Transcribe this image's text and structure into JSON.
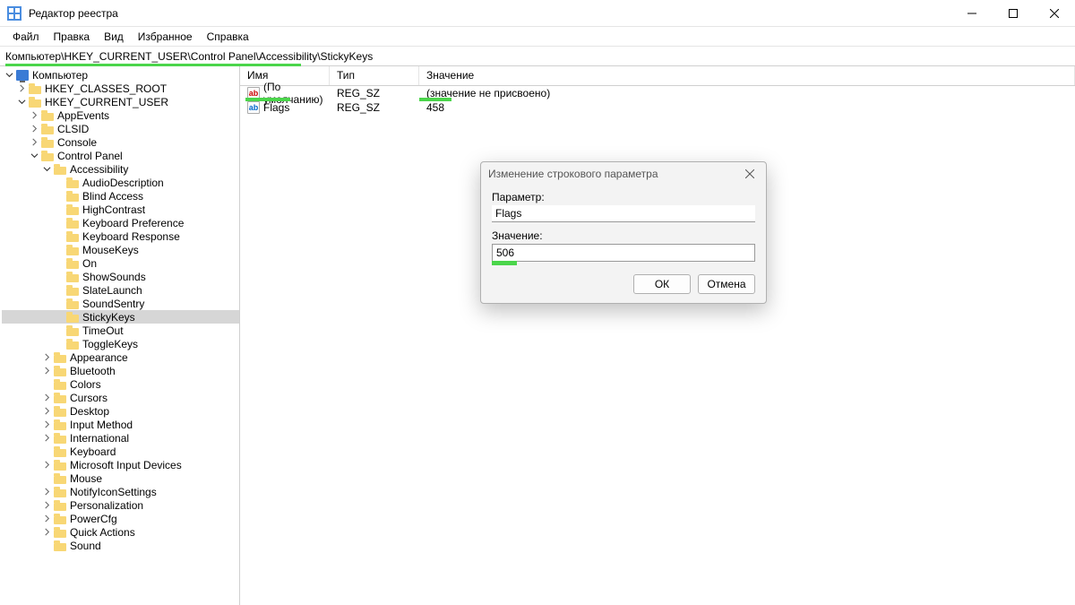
{
  "titlebar": {
    "title": "Редактор реестра"
  },
  "menubar": {
    "items": [
      "Файл",
      "Правка",
      "Вид",
      "Избранное",
      "Справка"
    ]
  },
  "addressbar": {
    "path": "Компьютер\\HKEY_CURRENT_USER\\Control Panel\\Accessibility\\StickyKeys"
  },
  "tree": [
    {
      "indent": 0,
      "label": "Компьютер",
      "icon": "computer",
      "expander": "open"
    },
    {
      "indent": 1,
      "label": "HKEY_CLASSES_ROOT",
      "icon": "folder",
      "expander": "closed"
    },
    {
      "indent": 1,
      "label": "HKEY_CURRENT_USER",
      "icon": "folder",
      "expander": "open"
    },
    {
      "indent": 2,
      "label": "AppEvents",
      "icon": "folder",
      "expander": "closed"
    },
    {
      "indent": 2,
      "label": "CLSID",
      "icon": "folder",
      "expander": "closed"
    },
    {
      "indent": 2,
      "label": "Console",
      "icon": "folder",
      "expander": "closed"
    },
    {
      "indent": 2,
      "label": "Control Panel",
      "icon": "folder",
      "expander": "open"
    },
    {
      "indent": 3,
      "label": "Accessibility",
      "icon": "folder",
      "expander": "open"
    },
    {
      "indent": 4,
      "label": "AudioDescription",
      "icon": "folder",
      "expander": "none"
    },
    {
      "indent": 4,
      "label": "Blind Access",
      "icon": "folder",
      "expander": "none"
    },
    {
      "indent": 4,
      "label": "HighContrast",
      "icon": "folder",
      "expander": "none"
    },
    {
      "indent": 4,
      "label": "Keyboard Preference",
      "icon": "folder",
      "expander": "none"
    },
    {
      "indent": 4,
      "label": "Keyboard Response",
      "icon": "folder",
      "expander": "none"
    },
    {
      "indent": 4,
      "label": "MouseKeys",
      "icon": "folder",
      "expander": "none"
    },
    {
      "indent": 4,
      "label": "On",
      "icon": "folder",
      "expander": "none"
    },
    {
      "indent": 4,
      "label": "ShowSounds",
      "icon": "folder",
      "expander": "none"
    },
    {
      "indent": 4,
      "label": "SlateLaunch",
      "icon": "folder",
      "expander": "none"
    },
    {
      "indent": 4,
      "label": "SoundSentry",
      "icon": "folder",
      "expander": "none"
    },
    {
      "indent": 4,
      "label": "StickyKeys",
      "icon": "folder",
      "expander": "none",
      "selected": true
    },
    {
      "indent": 4,
      "label": "TimeOut",
      "icon": "folder",
      "expander": "none"
    },
    {
      "indent": 4,
      "label": "ToggleKeys",
      "icon": "folder",
      "expander": "none"
    },
    {
      "indent": 3,
      "label": "Appearance",
      "icon": "folder",
      "expander": "closed"
    },
    {
      "indent": 3,
      "label": "Bluetooth",
      "icon": "folder",
      "expander": "closed"
    },
    {
      "indent": 3,
      "label": "Colors",
      "icon": "folder",
      "expander": "none"
    },
    {
      "indent": 3,
      "label": "Cursors",
      "icon": "folder",
      "expander": "closed"
    },
    {
      "indent": 3,
      "label": "Desktop",
      "icon": "folder",
      "expander": "closed"
    },
    {
      "indent": 3,
      "label": "Input Method",
      "icon": "folder",
      "expander": "closed"
    },
    {
      "indent": 3,
      "label": "International",
      "icon": "folder",
      "expander": "closed"
    },
    {
      "indent": 3,
      "label": "Keyboard",
      "icon": "folder",
      "expander": "none"
    },
    {
      "indent": 3,
      "label": "Microsoft Input Devices",
      "icon": "folder",
      "expander": "closed"
    },
    {
      "indent": 3,
      "label": "Mouse",
      "icon": "folder",
      "expander": "none"
    },
    {
      "indent": 3,
      "label": "NotifyIconSettings",
      "icon": "folder",
      "expander": "closed"
    },
    {
      "indent": 3,
      "label": "Personalization",
      "icon": "folder",
      "expander": "closed"
    },
    {
      "indent": 3,
      "label": "PowerCfg",
      "icon": "folder",
      "expander": "closed"
    },
    {
      "indent": 3,
      "label": "Quick Actions",
      "icon": "folder",
      "expander": "closed"
    },
    {
      "indent": 3,
      "label": "Sound",
      "icon": "folder",
      "expander": "none"
    }
  ],
  "values": {
    "columns": {
      "name": "Имя",
      "type": "Тип",
      "value": "Значение"
    },
    "rows": [
      {
        "icon": "str",
        "name": "(По умолчанию)",
        "type": "REG_SZ",
        "value": "(значение не присвоено)"
      },
      {
        "icon": "bin",
        "name": "Flags",
        "type": "REG_SZ",
        "value": "458"
      }
    ]
  },
  "dialog": {
    "title": "Изменение строкового параметра",
    "param_label": "Параметр:",
    "param_value": "Flags",
    "value_label": "Значение:",
    "value_value": "506",
    "ok": "ОК",
    "cancel": "Отмена"
  }
}
